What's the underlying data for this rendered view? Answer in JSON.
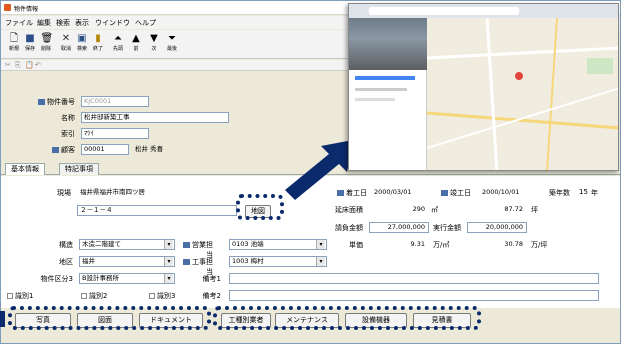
{
  "window": {
    "title": "物件情報"
  },
  "menu": [
    "ファイル",
    "編集",
    "検索",
    "表示",
    "ウインドウ",
    "ヘルプ"
  ],
  "toolbar": [
    {
      "label": "新規",
      "icon": "document-icon"
    },
    {
      "label": "保存",
      "icon": "save-icon"
    },
    {
      "label": "削除",
      "icon": "trash-icon"
    },
    {
      "label": "取消",
      "icon": "cancel-icon"
    },
    {
      "label": "検索",
      "icon": "search-icon"
    },
    {
      "label": "終了",
      "icon": "exit-icon"
    },
    {
      "label": "先頭",
      "icon": "first-icon"
    },
    {
      "label": "前",
      "icon": "prev-icon"
    },
    {
      "label": "次",
      "icon": "next-icon"
    },
    {
      "label": "最後",
      "icon": "last-icon"
    }
  ],
  "header": {
    "bukken_no_label": "物件番号",
    "bukken_no": "KJC0001",
    "name_label": "名称",
    "name": "松井邸新築工事",
    "index_label": "索引",
    "index": "ﾏﾂｲ",
    "client_label": "顧客",
    "client_code": "00001",
    "client_name": "松井 秀喜"
  },
  "tabs": [
    "基本情報",
    "特記事項"
  ],
  "basic": {
    "site_label": "現場",
    "site_line1": "福井県福井市南四ツ居",
    "site_line2": "２－１－４",
    "map_button": "地図",
    "start_label": "着工日",
    "start_date": "2000/03/01",
    "finish_label": "竣工日",
    "finish_date": "2000/10/01",
    "age_label": "築年数",
    "age": "15",
    "age_unit": "年",
    "floor_label": "延床面積",
    "floor_m2": "290",
    "unit_m2": "㎡",
    "floor_tsubo": "87.72",
    "unit_tsubo": "坪",
    "contract_label": "請負金額",
    "contract": "27,000,000",
    "budget_label": "実行金額",
    "budget": "20,000,000",
    "unitprice_label": "単価",
    "unitprice_m2": "9.31",
    "unit_man_m2": "万/㎡",
    "unitprice_tsubo": "30.78",
    "unit_man_tsubo": "万/坪",
    "struct_label": "構造",
    "struct": "木造二階建て",
    "area_label": "地区",
    "area": "福井",
    "class3_label": "物件区分3",
    "class3": "B設計事務所",
    "sales_label": "営業担当",
    "sales": "0103 池端",
    "works_label": "工事担当",
    "works": "1003 梅村",
    "note1_label": "備考1",
    "note2_label": "備考2",
    "checks": [
      "識別1",
      "識別2",
      "識別3"
    ]
  },
  "buttons_left": [
    "写真",
    "図面",
    "ドキュメント"
  ],
  "buttons_right": [
    "工種別業者",
    "メンテナンス",
    "設備機器",
    "見積書"
  ],
  "colors": {
    "accent": "#0a2a6b",
    "field_border": "#8aa2bc"
  }
}
